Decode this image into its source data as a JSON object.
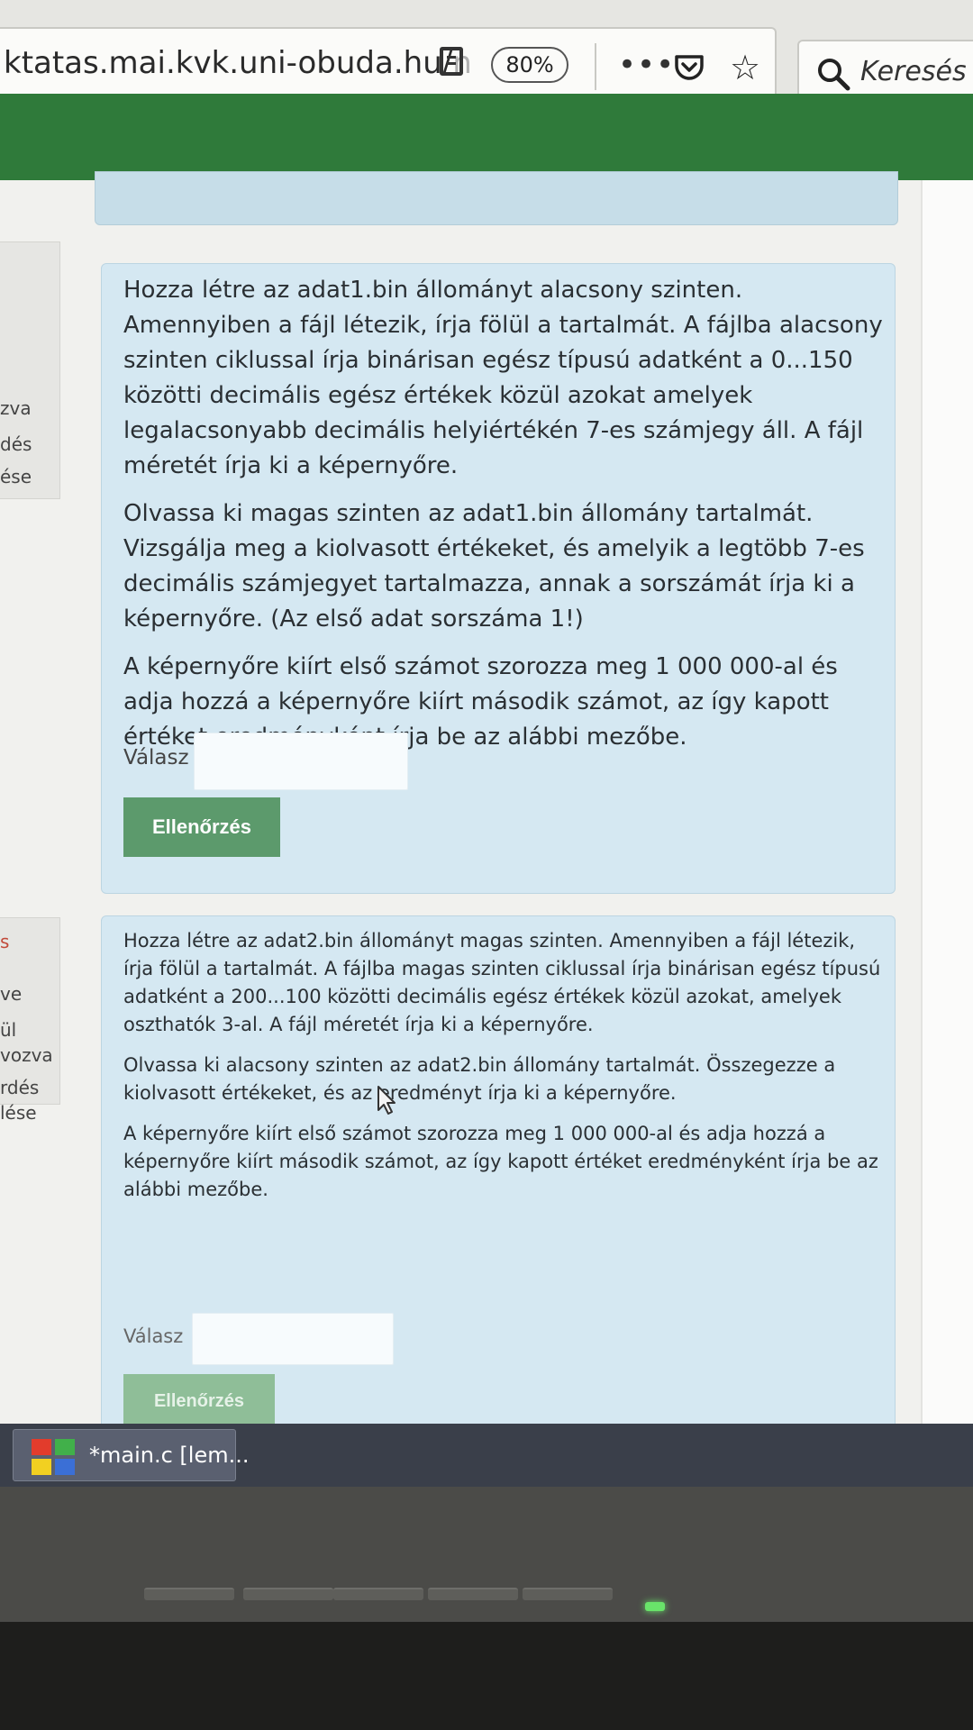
{
  "browser": {
    "url_visible": "ktatas.mai.kvk.uni-obuda.hu/",
    "url_cut": "n",
    "zoom": "80%",
    "more_label": "•••",
    "search_placeholder": "Keresés"
  },
  "left_panel_1": [
    "zva",
    "dés",
    "ése"
  ],
  "left_panel_2": [
    "s",
    "ve",
    "ül",
    "vozva",
    "rdés",
    "lése"
  ],
  "questions": [
    {
      "paragraphs": [
        "Hozza létre az adat1.bin állományt alacsony szinten. Amennyiben a fájl létezik, írja fölül a tartalmát. A fájlba alacsony  szinten ciklussal írja binárisan egész típusú adatként a 0...150 közötti decimális egész értékek közül azokat amelyek legalacsonyabb decimális helyiértékén 7-es számjegy áll. A fájl méretét írja ki a képernyőre.",
        "Olvassa ki magas szinten az adat1.bin állomány tartalmát. Vizsgálja meg a kiolvasott értékeket, és amelyik a legtöbb 7-es decimális számjegyet tartalmazza, annak a sorszámát írja ki a képernyőre. (Az első adat sorszáma 1!)",
        "A képernyőre kiírt első számot szorozza meg 1 000 000-al és adja hozzá a képernyőre kiírt második számot, az így kapott értéket eredményként írja be az alábbi mezőbe."
      ],
      "answer_label": "Válasz",
      "answer_value": "",
      "check_label": "Ellenőrzés"
    },
    {
      "paragraphs": [
        "Hozza létre az adat2.bin állományt magas szinten. Amennyiben a fájl létezik, írja fölül a tartalmát. A fájlba magas szinten ciklussal írja binárisan egész típusú adatként a 200...100 közötti decimális egész értékek közül azokat, amelyek oszthatók 3-al. A fájl méretét írja ki a képernyőre.",
        "Olvassa ki alacsony szinten az adat2.bin állomány tartalmát. Összegezze a kiolvasott értékeket, és az eredményt írja ki a képernyőre.",
        "A képernyőre kiírt első számot szorozza meg 1 000 000-al és adja hozzá a képernyőre kiírt második számot, az így kapott értéket eredményként írja be az alábbi mezőbe."
      ],
      "answer_label": "Válasz",
      "answer_value": "",
      "check_label": "Ellenőrzés"
    }
  ],
  "taskbar": {
    "item_label": "*main.c [lem..."
  },
  "colors": {
    "header_green": "#2f7a3a",
    "card_blue": "#d5e8f2",
    "button_green": "#5c9a6c"
  }
}
